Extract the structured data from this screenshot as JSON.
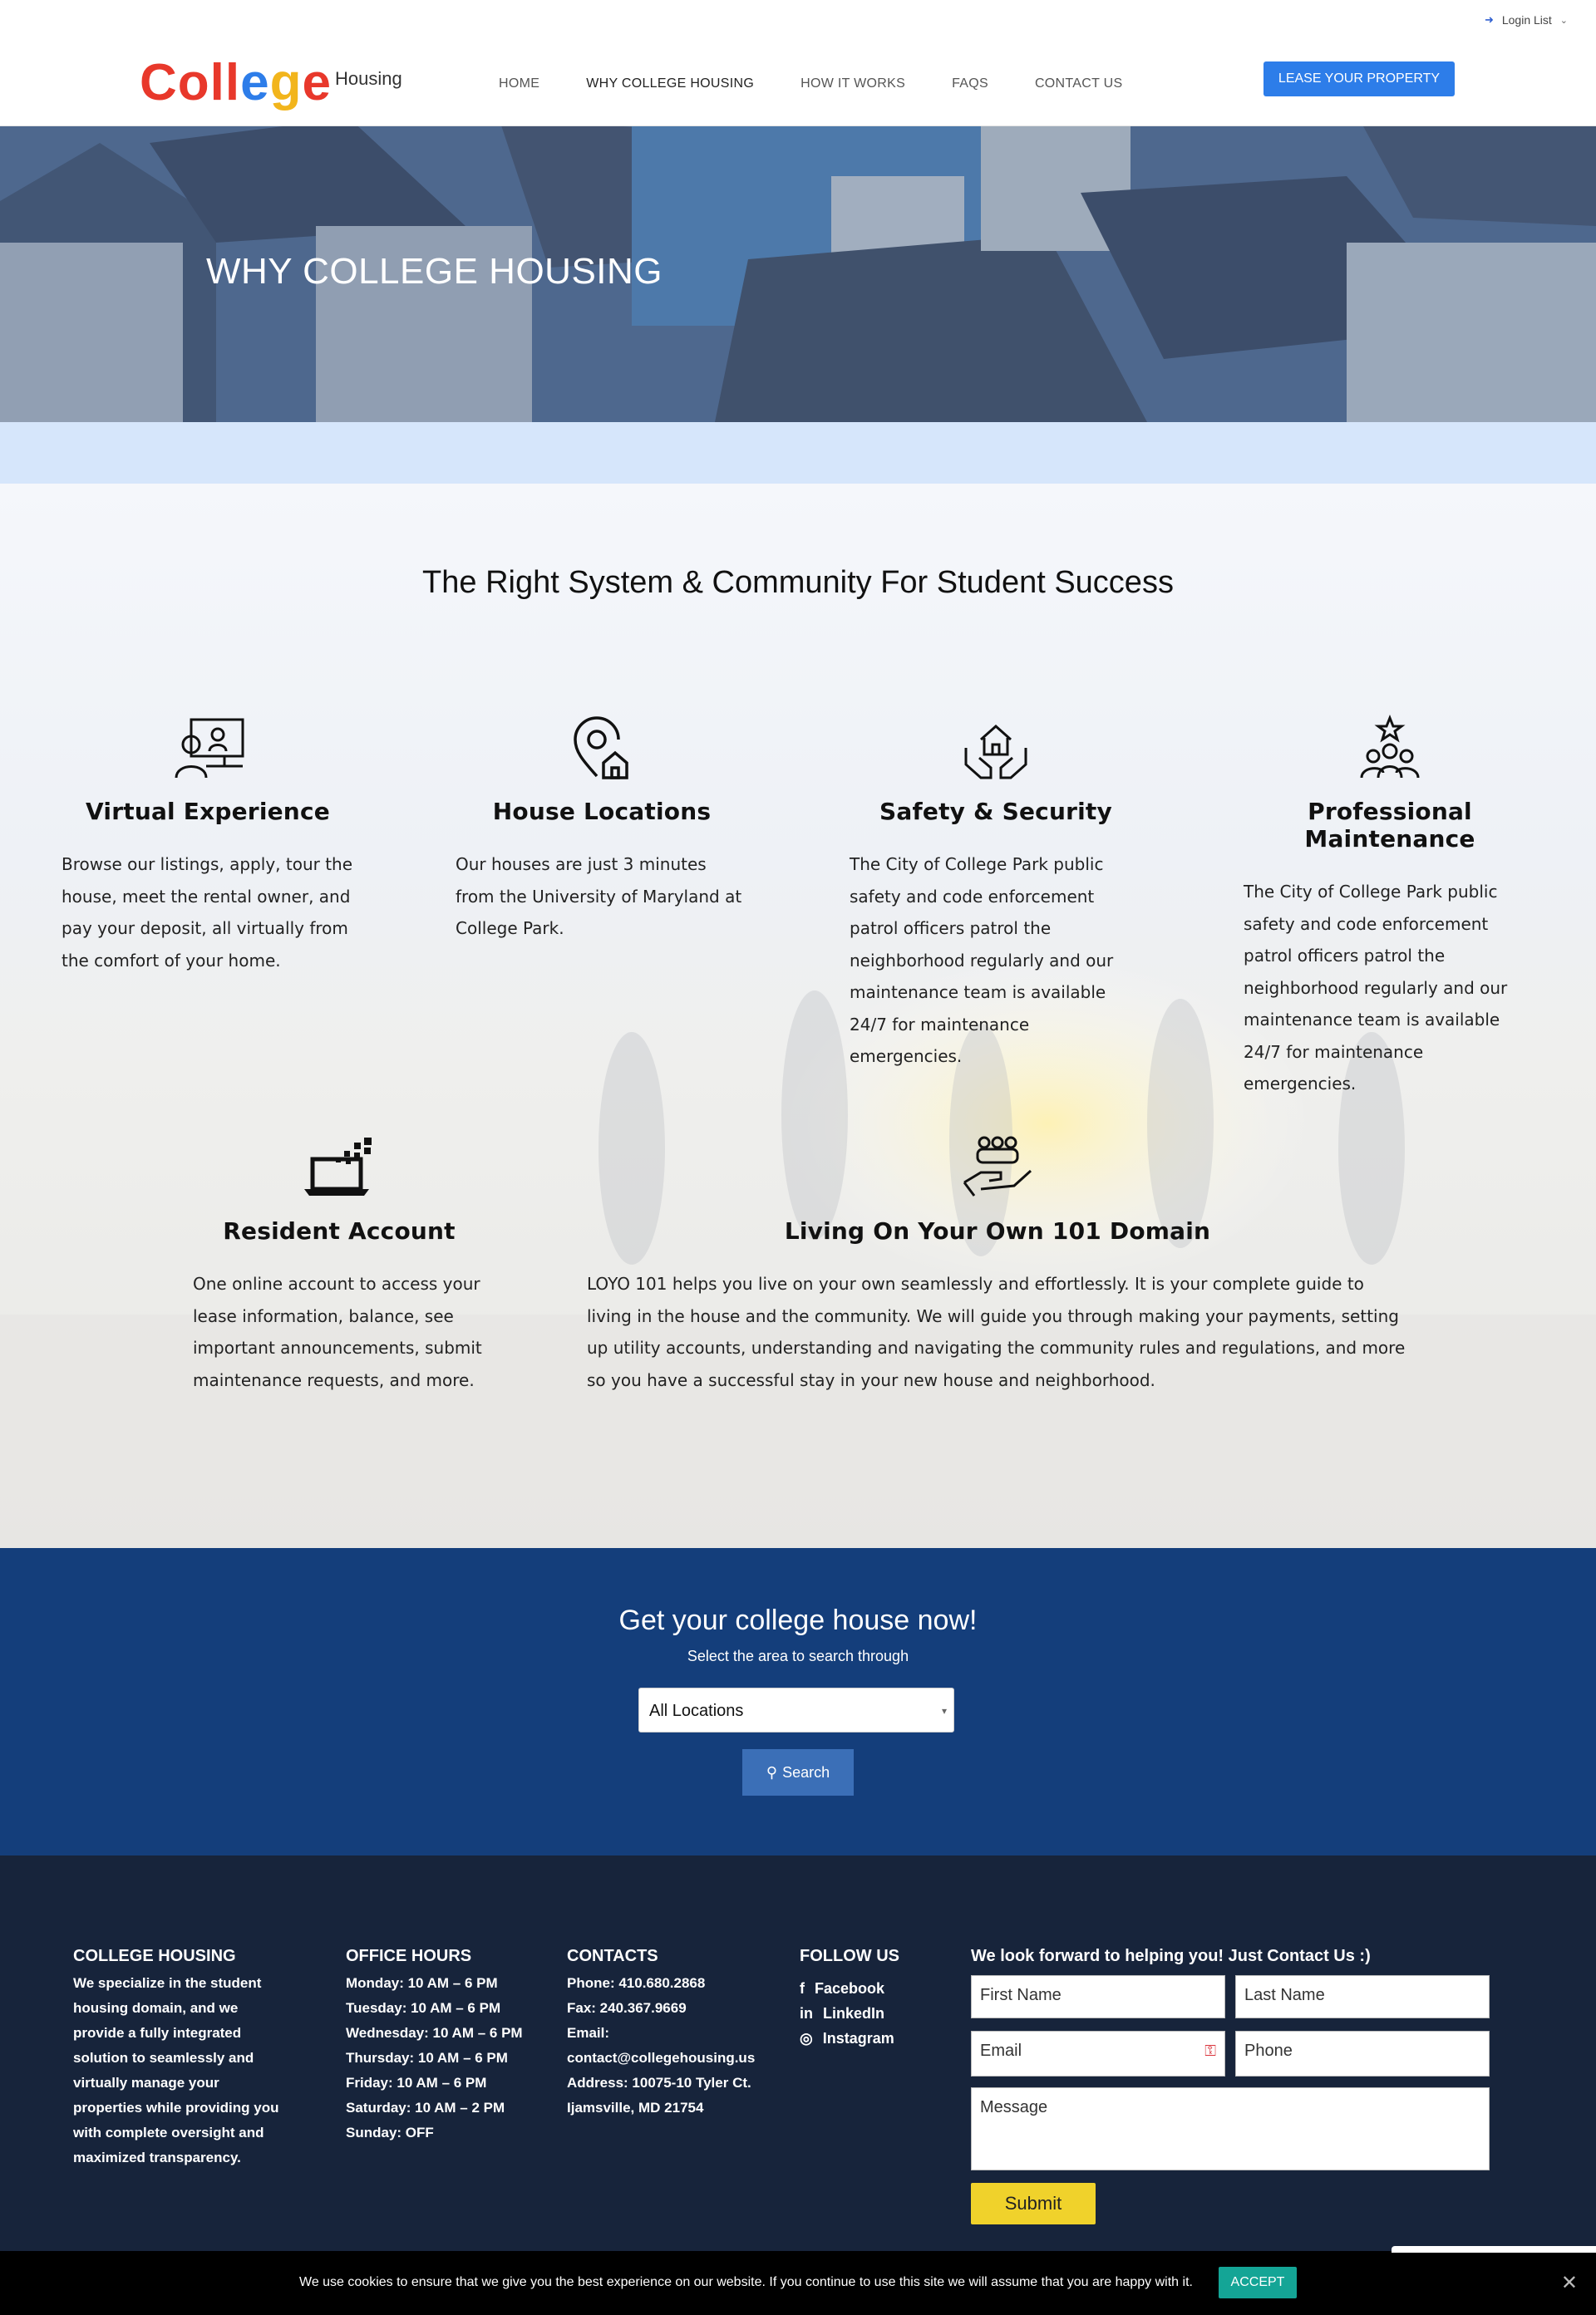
{
  "topbar": {
    "login_label": "Login List"
  },
  "header": {
    "logo": {
      "letters": [
        "C",
        "o",
        "l",
        "l",
        "e",
        "g",
        "e"
      ],
      "colors": [
        "#e8382b",
        "#e8382b",
        "#e8382b",
        "#e8382b",
        "#2d7de9",
        "#f2b51c",
        "#e8382b"
      ],
      "suffix": "Housing"
    },
    "nav": [
      "HOME",
      "WHY COLLEGE HOUSING",
      "HOW IT WORKS",
      "FAQS",
      "CONTACT US"
    ],
    "active_nav": "WHY COLLEGE HOUSING",
    "cta": "LEASE YOUR PROPERTY"
  },
  "hero": {
    "title": "WHY COLLEGE HOUSING"
  },
  "features": {
    "heading": "The Right System & Community For Student Success",
    "items": [
      {
        "icon": "presentation-icon",
        "title": "Virtual Experience",
        "text": "Browse our listings, apply, tour the house, meet the rental owner, and pay your deposit, all virtually from the comfort of your home."
      },
      {
        "icon": "location-home-icon",
        "title": "House Locations",
        "text": "Our houses are just 3 minutes from the University of Maryland at College Park."
      },
      {
        "icon": "house-hands-icon",
        "title": "Safety & Security",
        "text": "The City of College Park public safety and code enforcement patrol officers patrol the neighborhood regularly and our maintenance team is available 24/7 for maintenance emergencies."
      },
      {
        "icon": "team-star-icon",
        "title": "Professional Maintenance",
        "text": "The City of College Park public safety and code enforcement patrol officers patrol the neighborhood regularly and our maintenance team is available 24/7 for maintenance emergencies."
      },
      {
        "icon": "laptop-icon",
        "title": "Resident Account",
        "text": "One online account to access your lease information, balance, see important announcements, submit maintenance requests, and more."
      },
      {
        "icon": "community-hand-icon",
        "title": "Living On Your Own 101 Domain",
        "text": "LOYO 101 helps you live on your own seamlessly and effortlessly. It is your complete guide to living in the house and the community. We will guide you through making your payments, setting up utility accounts, understanding and navigating the community rules and regulations, and more so you have a successful stay in your new house and neighborhood."
      }
    ]
  },
  "search": {
    "title": "Get your college house now!",
    "subtitle": "Select the area to search through",
    "selected": "All Locations",
    "button": "Search"
  },
  "footer": {
    "about": {
      "title": "COLLEGE HOUSING",
      "lines": [
        "We specialize in the student",
        "housing domain, and we",
        "provide a fully integrated",
        "solution to seamlessly and",
        "virtually manage your",
        "properties while providing you",
        "with complete oversight and",
        "maximized transparency."
      ]
    },
    "hours": {
      "title": "OFFICE HOURS",
      "lines": [
        "Monday: 10 AM – 6 PM",
        "Tuesday: 10 AM – 6 PM",
        "Wednesday: 10 AM – 6 PM",
        "Thursday: 10 AM – 6 PM",
        "Friday: 10 AM – 6 PM",
        "Saturday: 10 AM – 2 PM",
        "Sunday: OFF"
      ]
    },
    "contacts": {
      "title": "CONTACTS",
      "lines": [
        "Phone: 410.680.2868",
        "Fax: 240.367.9669",
        "Email:",
        "contact@collegehousing.us",
        "Address: 10075-10 Tyler Ct.",
        "Ijamsville, MD 21754"
      ]
    },
    "follow": {
      "title": "FOLLOW US",
      "items": [
        "Facebook",
        "LinkedIn",
        "Instagram"
      ]
    },
    "form": {
      "title": "We look forward to helping you! Just Contact Us :)",
      "first": "First Name",
      "last": "Last Name",
      "email": "Email",
      "phone": "Phone",
      "message": "Message",
      "submit": "Submit"
    }
  },
  "cookie": {
    "text": "We use cookies to ensure that we give you the best experience on our website. If you continue to use this site we will assume that you are happy with it.",
    "accept": "ACCEPT"
  }
}
